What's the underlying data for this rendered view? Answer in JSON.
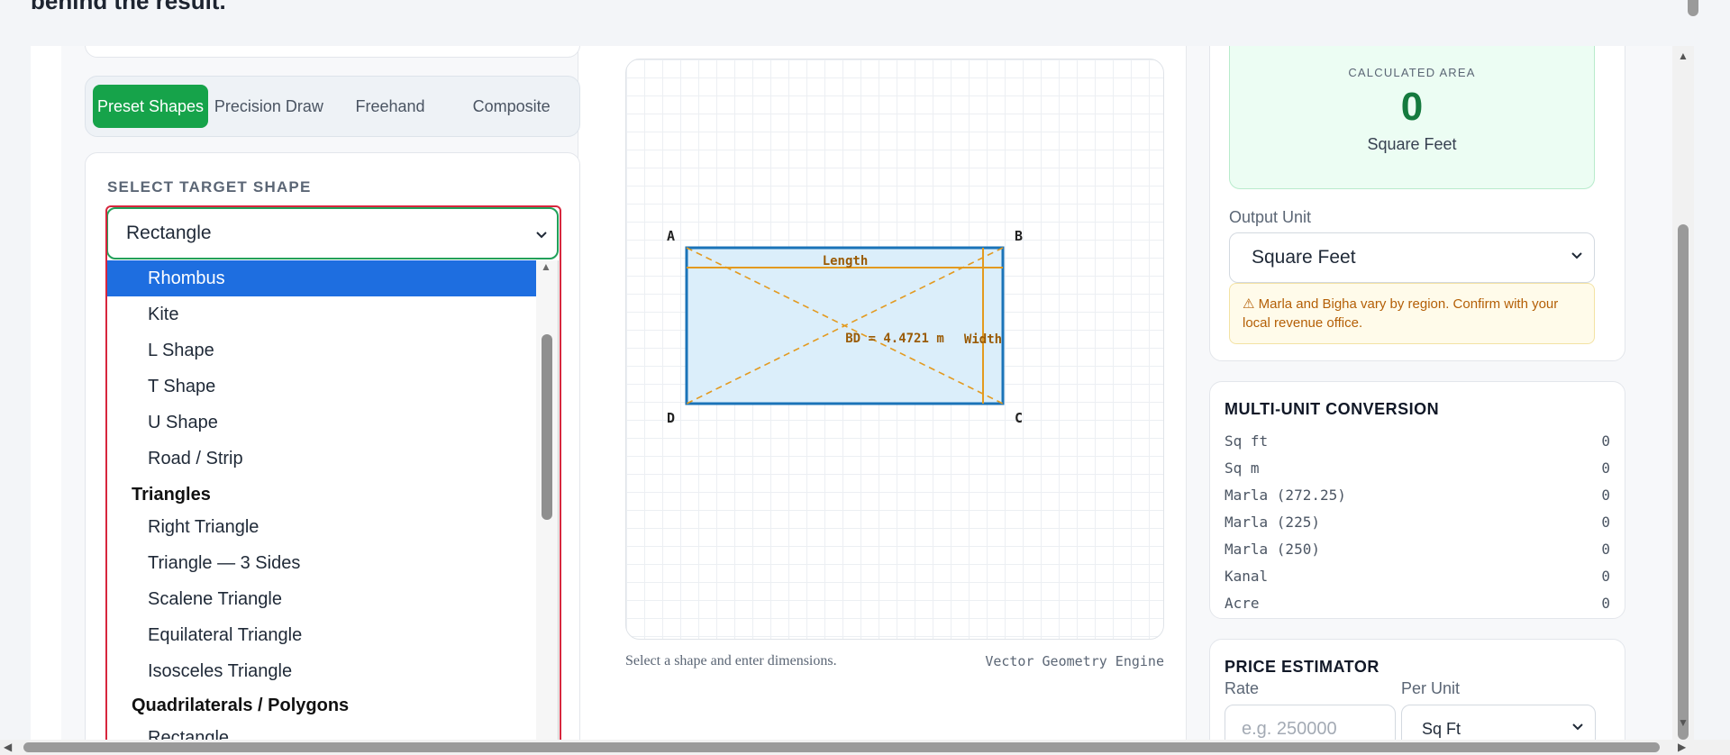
{
  "header": {
    "intro_fragment": "behind the result."
  },
  "mode_tabs": [
    "Preset Shapes",
    "Precision Draw",
    "Freehand",
    "Composite"
  ],
  "shape_selector": {
    "label": "SELECT TARGET SHAPE",
    "selected": "Rectangle",
    "options_visible": {
      "highlighted": "Rhombus",
      "items_before_groups": [
        "Kite",
        "L Shape",
        "T Shape",
        "U Shape",
        "Road / Strip"
      ],
      "group_triangles": "Triangles",
      "triangles": [
        "Right Triangle",
        "Triangle — 3 Sides",
        "Scalene Triangle",
        "Equilateral Triangle",
        "Isosceles Triangle"
      ],
      "group_quads": "Quadrilaterals / Polygons",
      "quads": [
        "Rectangle"
      ]
    }
  },
  "canvas": {
    "vertices": {
      "a": "A",
      "b": "B",
      "c": "C",
      "d": "D"
    },
    "length_label": "Length",
    "width_label": "Width",
    "diagonal_label": "BD = 4.4721 m",
    "caption": "Select a shape and enter dimensions.",
    "engine": "Vector Geometry Engine",
    "colors": {
      "fill": "#dbeefa",
      "stroke": "#1a73b8",
      "dimension": "#e39a1f",
      "label": "#9a5b05"
    }
  },
  "result": {
    "label": "CALCULATED AREA",
    "value": "0",
    "unit": "Square Feet",
    "output_unit_label": "Output Unit",
    "output_unit_value": "Square Feet",
    "warning": "⚠ Marla and Bigha vary by region. Confirm with your local revenue office."
  },
  "conversion": {
    "title": "MULTI-UNIT CONVERSION",
    "rows": [
      {
        "unit": "Sq ft",
        "value": "0"
      },
      {
        "unit": "Sq m",
        "value": "0"
      },
      {
        "unit": "Marla (272.25)",
        "value": "0"
      },
      {
        "unit": "Marla (225)",
        "value": "0"
      },
      {
        "unit": "Marla (250)",
        "value": "0"
      },
      {
        "unit": "Kanal",
        "value": "0"
      },
      {
        "unit": "Acre",
        "value": "0"
      }
    ]
  },
  "price": {
    "title": "PRICE ESTIMATOR",
    "rate_label": "Rate",
    "rate_placeholder": "e.g. 250000",
    "per_unit_label": "Per Unit",
    "per_unit_value": "Sq Ft"
  },
  "theme": {
    "accent": "#16a34a",
    "select_highlight": "#1e6ee0",
    "outline_red": "#d7263d"
  }
}
